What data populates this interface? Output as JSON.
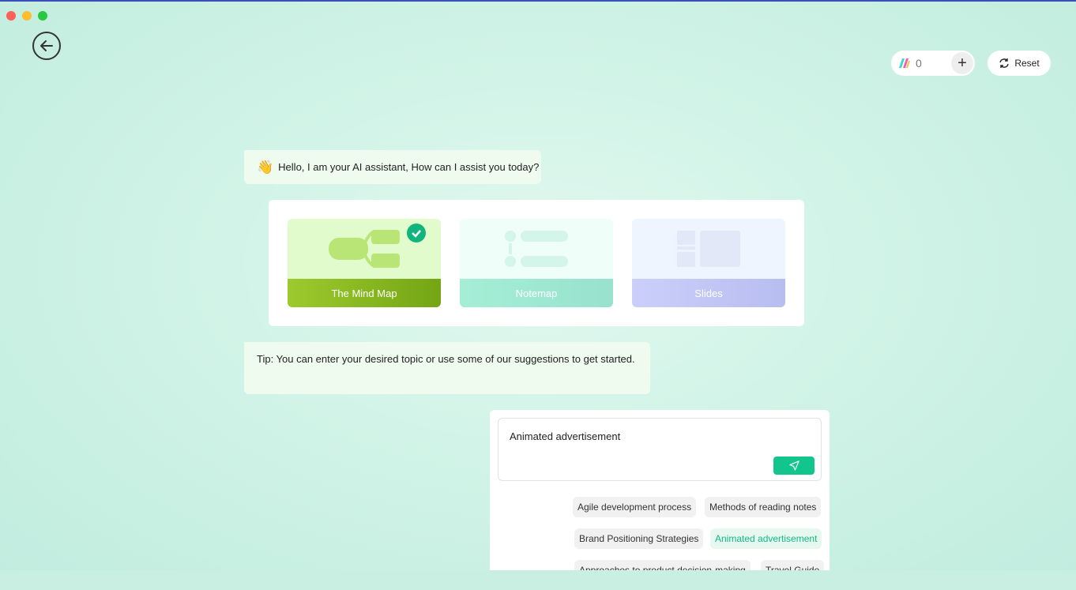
{
  "window": {
    "controls": [
      "close",
      "minimize",
      "maximize"
    ]
  },
  "header": {
    "credits": "0",
    "reset_label": "Reset"
  },
  "greeting": {
    "emoji": "👋",
    "text": "Hello, I am your AI assistant, How can I assist you today?"
  },
  "modes": [
    {
      "label": "The Mind Map",
      "selected": true
    },
    {
      "label": "Notemap",
      "selected": false
    },
    {
      "label": "Slides",
      "selected": false
    }
  ],
  "tip": "Tip: You can enter your desired topic or use some of our suggestions to get started.",
  "input": {
    "value": "Animated advertisement"
  },
  "suggestions": [
    "Agile development process",
    "Methods of reading notes",
    "Brand Positioning Strategies",
    "Animated advertisement",
    "Approaches to product decision-making",
    "Travel Guide"
  ],
  "colors": {
    "accent": "#12c58d"
  }
}
